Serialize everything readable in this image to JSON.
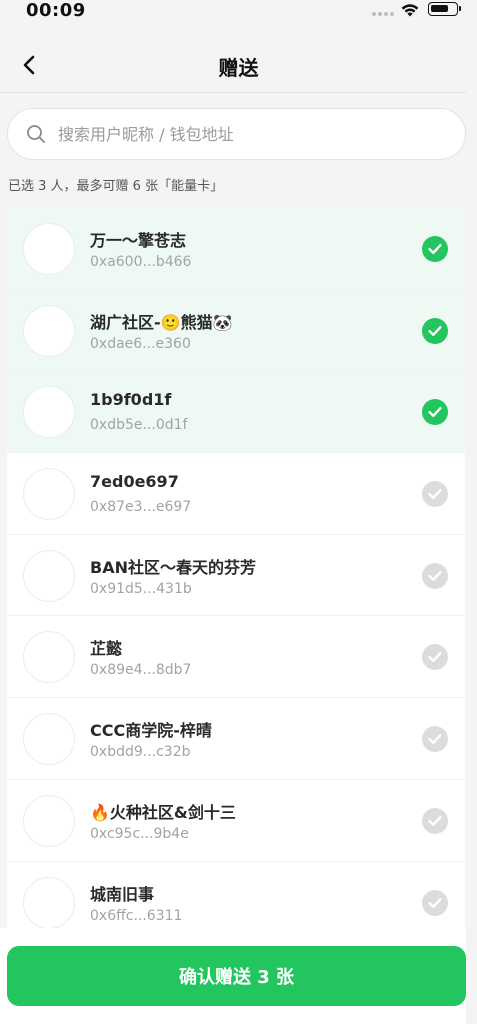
{
  "status_bar": {
    "time": "00:09"
  },
  "nav": {
    "title": "赠送"
  },
  "search": {
    "placeholder": "搜索用户昵称 / 钱包地址",
    "value": ""
  },
  "hint": "已选 3 人，最多可赠 6 张「能量卡」",
  "list": [
    {
      "name": "万一～擎苍志",
      "address": "0xa600...b466",
      "selected": true
    },
    {
      "name": "湖广社区-🙂熊猫🐼",
      "address": "0xdae6...e360",
      "selected": true
    },
    {
      "name": "1b9f0d1f",
      "address": "0xdb5e...0d1f",
      "selected": true
    },
    {
      "name": "7ed0e697",
      "address": "0x87e3...e697",
      "selected": false
    },
    {
      "name": "BAN社区～春天的芬芳",
      "address": "0x91d5...431b",
      "selected": false
    },
    {
      "name": "芷懿",
      "address": "0x89e4...8db7",
      "selected": false
    },
    {
      "name": "CCC商学院-梓晴",
      "address": "0xbdd9...c32b",
      "selected": false
    },
    {
      "name": "🔥火种社区&剑十三",
      "address": "0xc95c...9b4e",
      "selected": false
    },
    {
      "name": "城南旧事",
      "address": "0x6ffc...6311",
      "selected": false
    }
  ],
  "confirm_button": {
    "label": "确认赠送 3 张"
  },
  "colors": {
    "accent": "#22c55e",
    "selected_row": "#eff9f4",
    "check_off": "#dcdcdc"
  }
}
